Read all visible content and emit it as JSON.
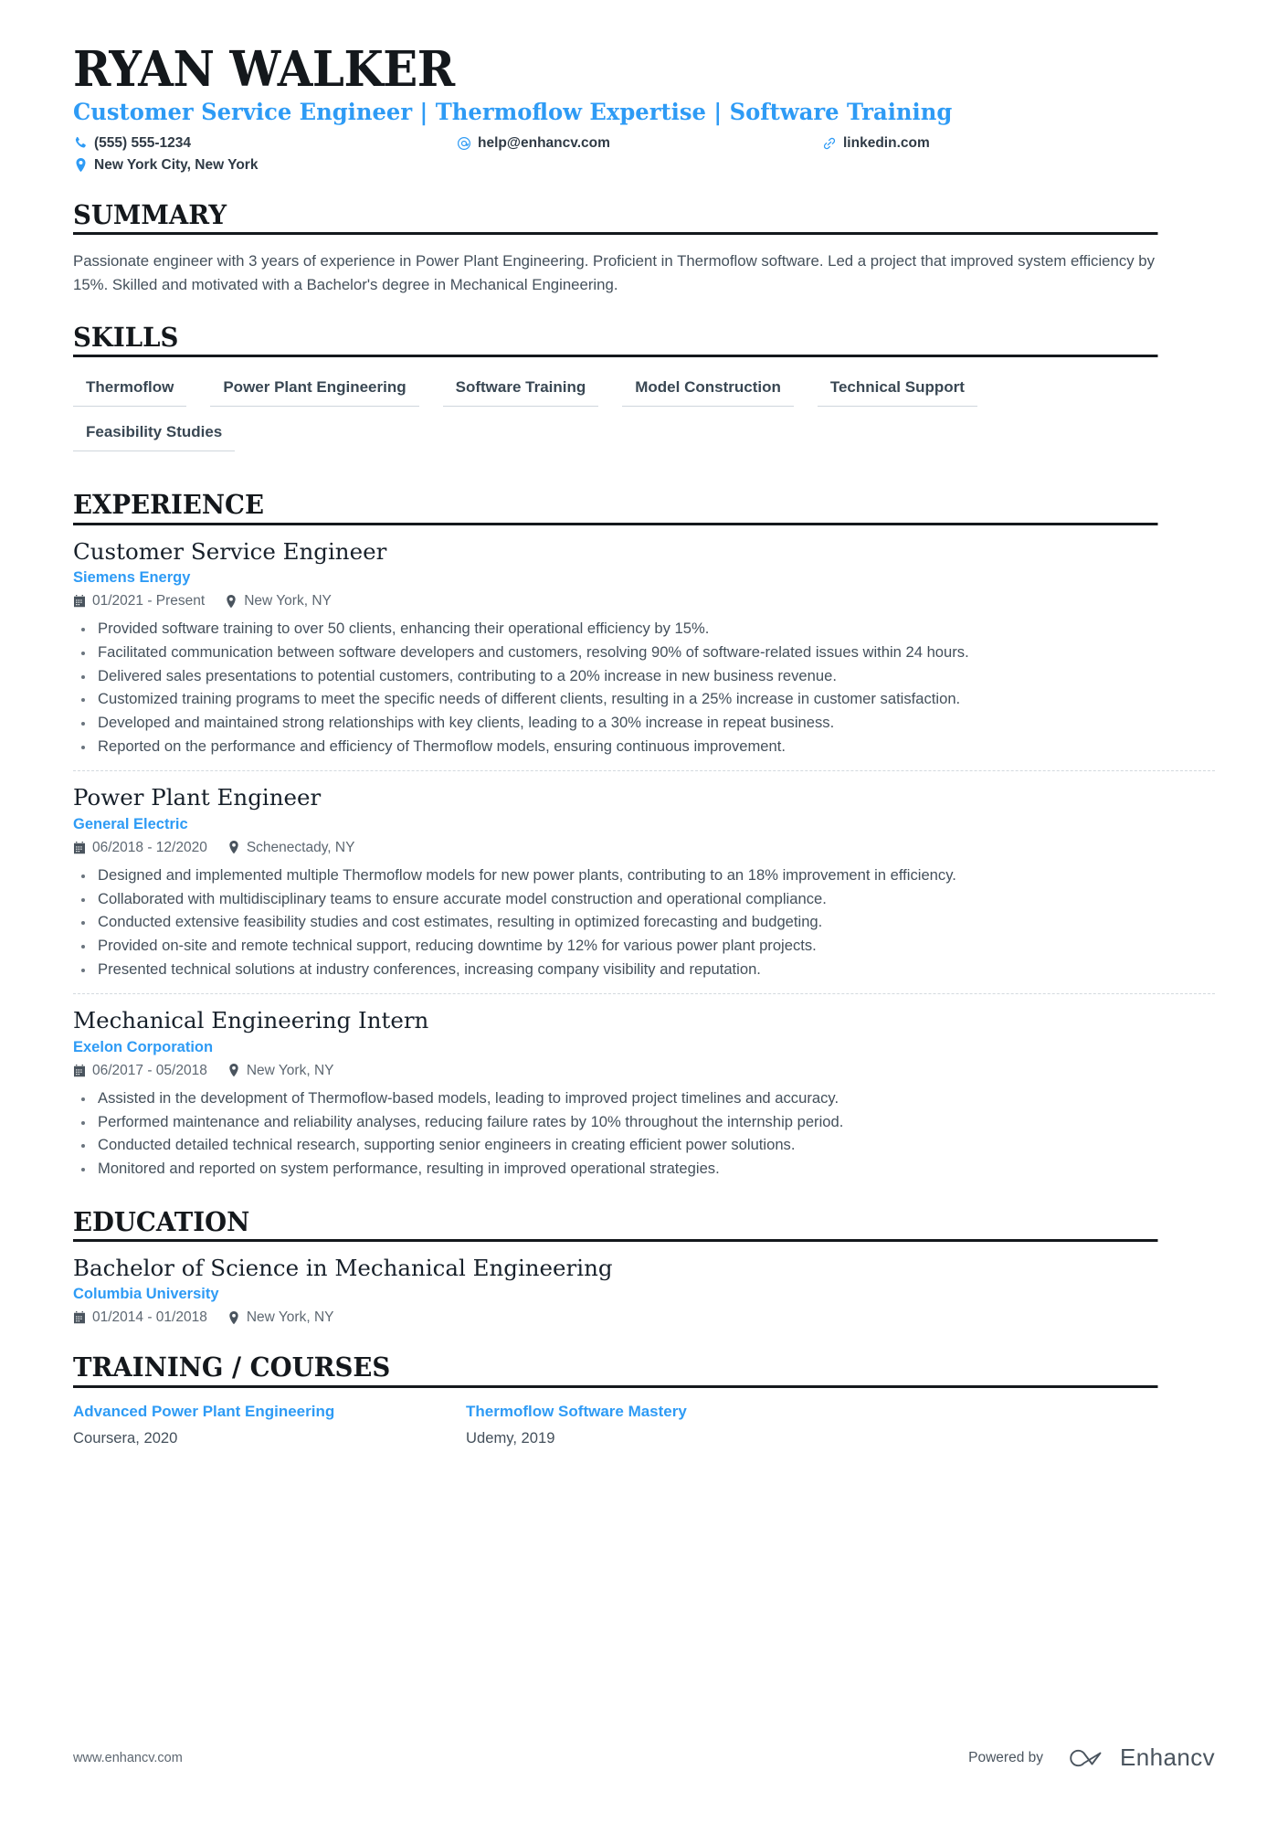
{
  "header": {
    "name": "RYAN WALKER",
    "headline": "Customer Service Engineer | Thermoflow Expertise | Software Training",
    "contacts": [
      {
        "icon": "phone-icon",
        "text": "(555) 555-1234"
      },
      {
        "icon": "email-icon",
        "text": "help@enhancv.com"
      },
      {
        "icon": "link-icon",
        "text": "linkedin.com"
      },
      {
        "icon": "location-icon",
        "text": "New York City, New York"
      }
    ]
  },
  "sections": {
    "summary": {
      "heading": "SUMMARY",
      "text": "Passionate engineer with 3 years of experience in Power Plant Engineering. Proficient in Thermoflow software. Led a project that improved system efficiency by 15%. Skilled and motivated with a Bachelor's degree in Mechanical Engineering."
    },
    "skills": {
      "heading": "SKILLS",
      "items": [
        "Thermoflow",
        "Power Plant Engineering",
        "Software Training",
        "Model Construction",
        "Technical Support",
        "Feasibility Studies"
      ]
    },
    "experience": {
      "heading": "EXPERIENCE",
      "entries": [
        {
          "title": "Customer Service Engineer",
          "org": "Siemens Energy",
          "dates": "01/2021 - Present",
          "location": "New York, NY",
          "bullets": [
            "Provided software training to over 50 clients, enhancing their operational efficiency by 15%.",
            "Facilitated communication between software developers and customers, resolving 90% of software-related issues within 24 hours.",
            "Delivered sales presentations to potential customers, contributing to a 20% increase in new business revenue.",
            "Customized training programs to meet the specific needs of different clients, resulting in a 25% increase in customer satisfaction.",
            "Developed and maintained strong relationships with key clients, leading to a 30% increase in repeat business.",
            "Reported on the performance and efficiency of Thermoflow models, ensuring continuous improvement."
          ]
        },
        {
          "title": "Power Plant Engineer",
          "org": "General Electric",
          "dates": "06/2018 - 12/2020",
          "location": "Schenectady, NY",
          "bullets": [
            "Designed and implemented multiple Thermoflow models for new power plants, contributing to an 18% improvement in efficiency.",
            "Collaborated with multidisciplinary teams to ensure accurate model construction and operational compliance.",
            "Conducted extensive feasibility studies and cost estimates, resulting in optimized forecasting and budgeting.",
            "Provided on-site and remote technical support, reducing downtime by 12% for various power plant projects.",
            "Presented technical solutions at industry conferences, increasing company visibility and reputation."
          ]
        },
        {
          "title": "Mechanical Engineering Intern",
          "org": "Exelon Corporation",
          "dates": "06/2017 - 05/2018",
          "location": "New York, NY",
          "bullets": [
            "Assisted in the development of Thermoflow-based models, leading to improved project timelines and accuracy.",
            "Performed maintenance and reliability analyses, reducing failure rates by 10% throughout the internship period.",
            "Conducted detailed technical research, supporting senior engineers in creating efficient power solutions.",
            "Monitored and reported on system performance, resulting in improved operational strategies."
          ]
        }
      ]
    },
    "education": {
      "heading": "EDUCATION",
      "entries": [
        {
          "title": "Bachelor of Science in Mechanical Engineering",
          "org": "Columbia University",
          "dates": "01/2014 - 01/2018",
          "location": "New York, NY"
        }
      ]
    },
    "courses": {
      "heading": "TRAINING / COURSES",
      "items": [
        {
          "title": "Advanced Power Plant Engineering",
          "sub": "Coursera, 2020"
        },
        {
          "title": "Thermoflow Software Mastery",
          "sub": "Udemy, 2019"
        }
      ]
    }
  },
  "footer": {
    "url": "www.enhancv.com",
    "powered_by": "Powered by",
    "brand": "Enhancv"
  },
  "colors": {
    "accent": "#2e9bf5",
    "ink": "#14181c",
    "body": "#44505b",
    "muted": "#5d6771",
    "rule": "#cfd6dc"
  }
}
